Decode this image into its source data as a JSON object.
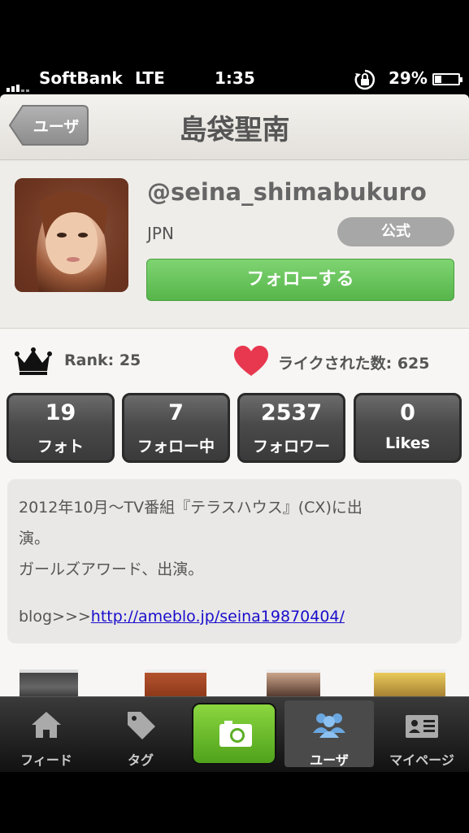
{
  "status_bar": {
    "carrier": "SoftBank",
    "network": "LTE",
    "time": "1:35",
    "battery": "29%",
    "battery_level": 0.29
  },
  "nav": {
    "back_label": "ユーザ",
    "title": "島袋聖南"
  },
  "profile": {
    "username": "@seina_shimabukuro",
    "country": "JPN",
    "official_badge": "公式",
    "follow_button": "フォローする"
  },
  "rank": {
    "label": "Rank: 25"
  },
  "likes": {
    "label": "ライクされた数: 625"
  },
  "stats": [
    {
      "value": "19",
      "label": "フォト"
    },
    {
      "value": "7",
      "label": "フォロー中"
    },
    {
      "value": "2537",
      "label": "フォロワー"
    },
    {
      "value": "0",
      "label": "Likes"
    }
  ],
  "bio": {
    "line1": "2012年10月～TV番組『テラスハウス』(CX)に出",
    "line2": "演。",
    "line3": "ガールズアワード、出演。",
    "blog_prefix": "blog>>>",
    "blog_url": "http://ameblo.jp/seina19870404/"
  },
  "tabs": [
    {
      "label": "フィード",
      "icon": "home-icon"
    },
    {
      "label": "タグ",
      "icon": "tag-icon"
    },
    {
      "label": "",
      "icon": "camera-icon"
    },
    {
      "label": "ユーザ",
      "icon": "users-icon"
    },
    {
      "label": "マイページ",
      "icon": "profile-card-icon"
    }
  ],
  "colors": {
    "follow_green": "#5cbf4e",
    "heart_red": "#e8384f",
    "link_blue": "#1a0dcc",
    "camera_green": "#6cc22a"
  }
}
